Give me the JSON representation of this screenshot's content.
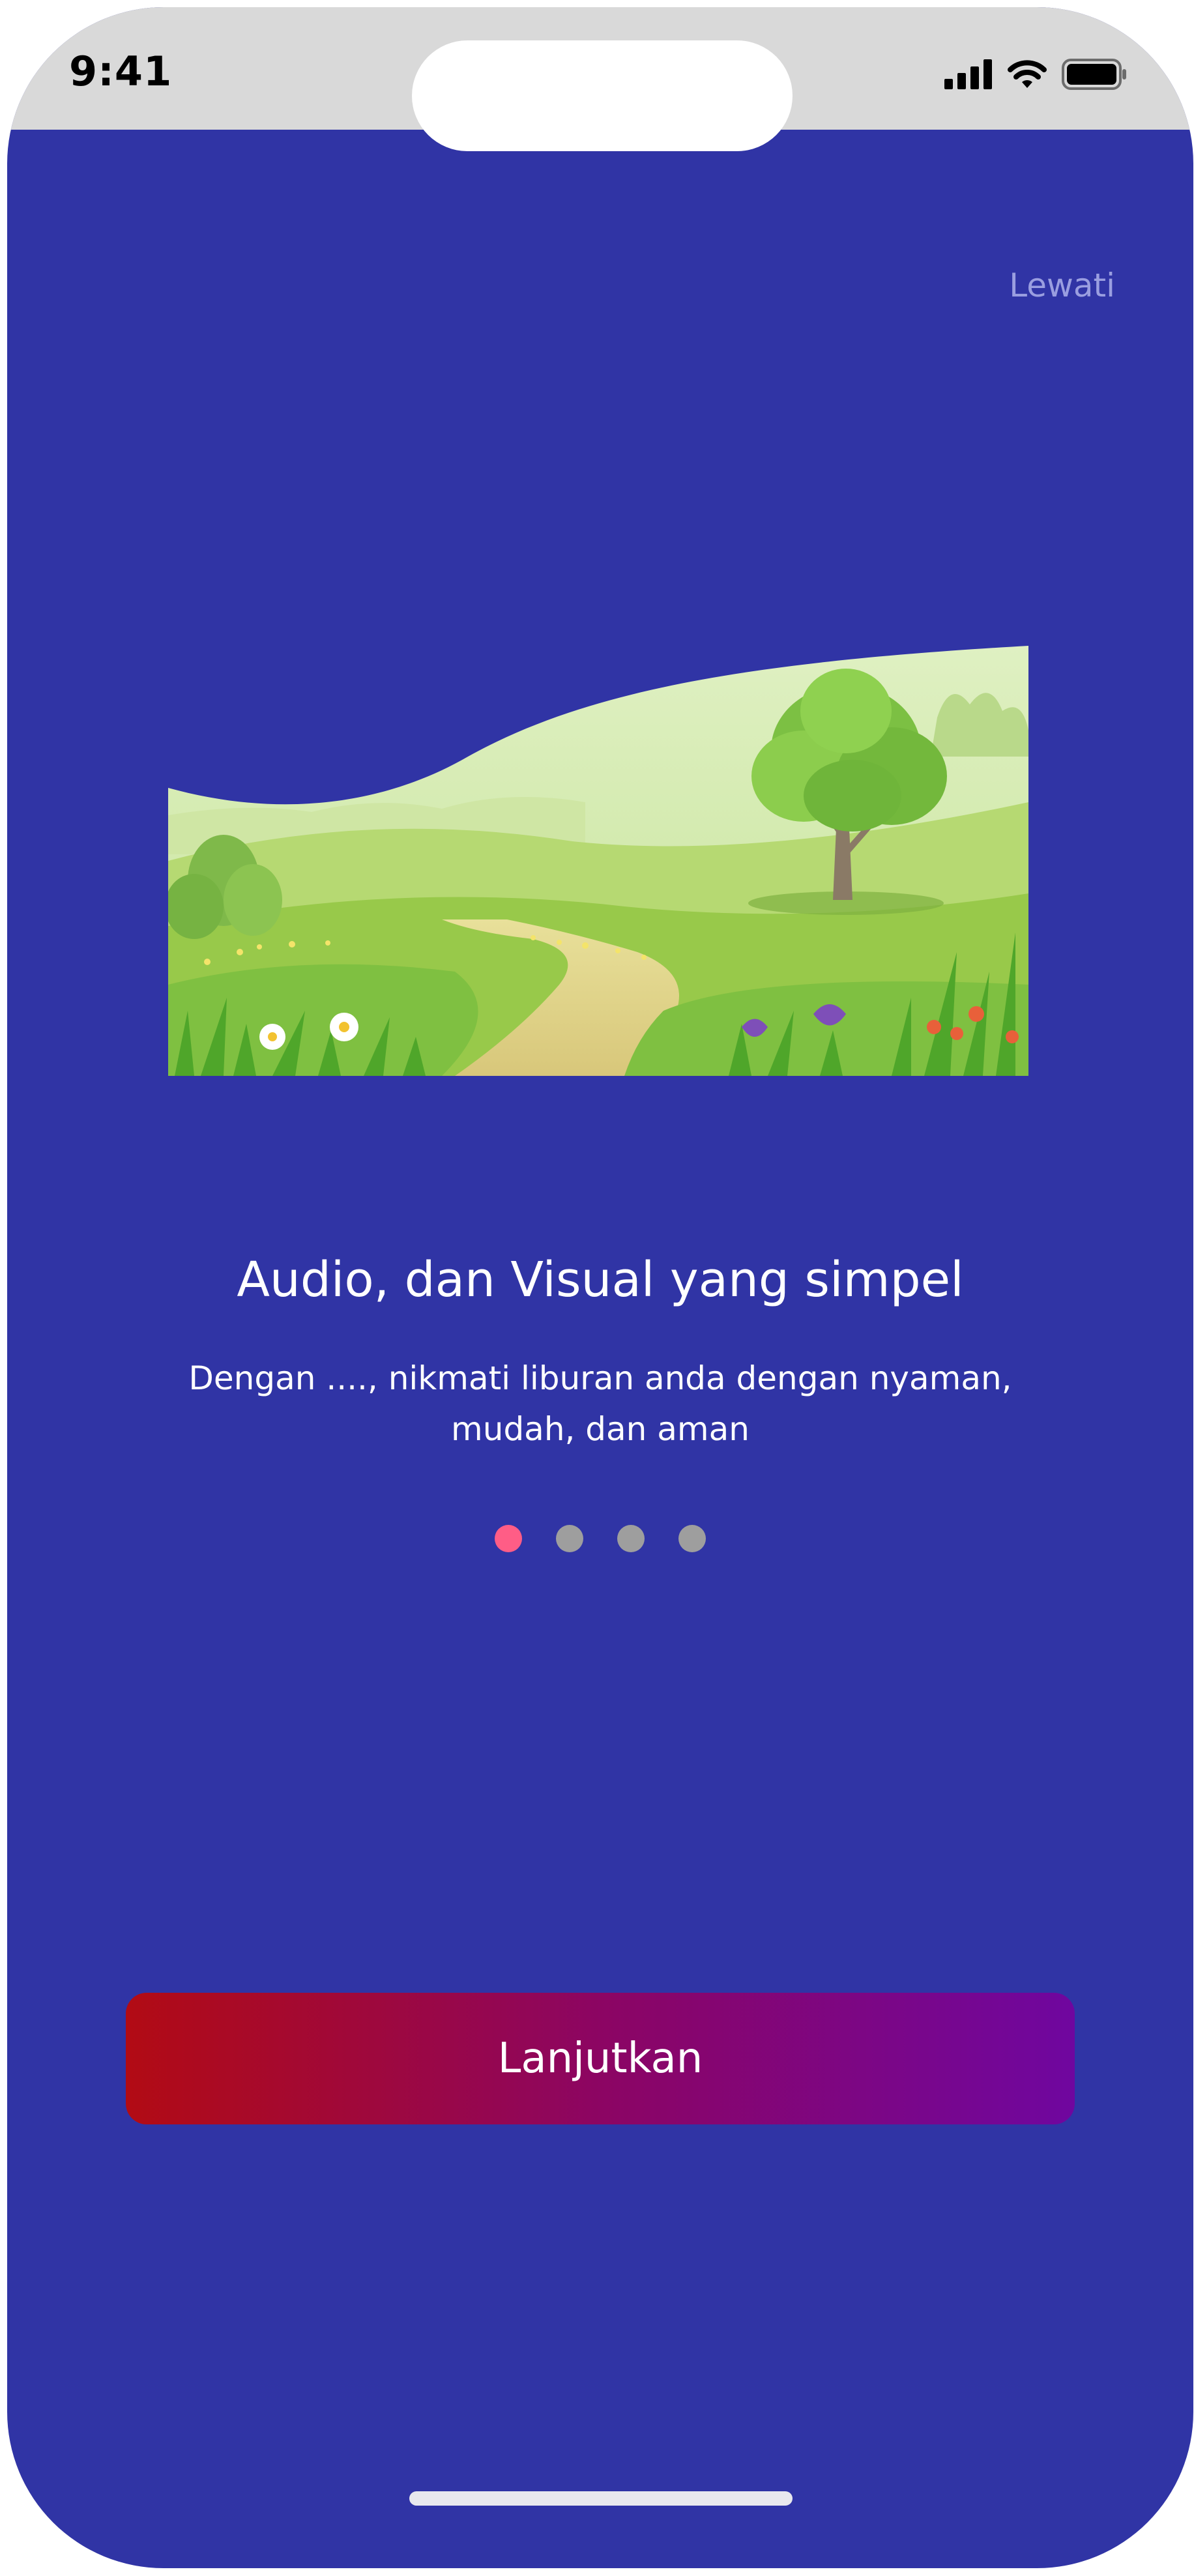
{
  "status_bar": {
    "time": "9:41",
    "icons": [
      "signal-icon",
      "wifi-icon",
      "battery-icon"
    ]
  },
  "onboarding": {
    "skip_label": "Lewati",
    "illustration": "landscape-hills-path-tree",
    "title": "Audio, dan Visual yang simpel",
    "description": "Dengan ...., nikmati liburan anda dengan nyaman, mudah, dan aman",
    "page_count": 4,
    "active_page": 1,
    "continue_label": "Lanjutkan"
  },
  "colors": {
    "background": "#3034a5",
    "status_bar": "#d9d9d9",
    "dot_active": "#ff5d86",
    "dot_inactive": "#9e9e9e",
    "button_gradient_start": "#b20b14",
    "button_gradient_end": "#6f069f",
    "skip_text": "#9a9ee0"
  }
}
